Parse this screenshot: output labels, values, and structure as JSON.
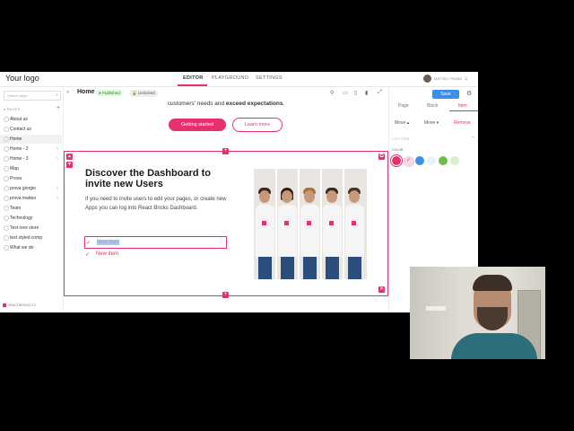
{
  "app": {
    "logo": "Your logo",
    "user_name": "MATTEO FRANA"
  },
  "top_nav": [
    {
      "label": "EDITOR",
      "active": true
    },
    {
      "label": "PLAYGROUND",
      "active": false
    },
    {
      "label": "SETTINGS",
      "active": false
    }
  ],
  "sidebar": {
    "search_placeholder": "Search page",
    "section_label": "PAGES",
    "items": [
      {
        "label": "About us"
      },
      {
        "label": "Contact us"
      },
      {
        "label": "Home",
        "active": true
      },
      {
        "label": "Home - 2"
      },
      {
        "label": "Home - 3"
      },
      {
        "label": "Map"
      },
      {
        "label": "Prova"
      },
      {
        "label": "prova giorgio"
      },
      {
        "label": "prova matteo"
      },
      {
        "label": "Team"
      },
      {
        "label": "Technology"
      },
      {
        "label": "Test new store"
      },
      {
        "label": "test styled comp"
      },
      {
        "label": "What we do"
      }
    ],
    "footer": "REACTBRICKS 2.0"
  },
  "toolbar": {
    "page_title": "Home",
    "status_published": "Published",
    "status_unlocked": "Unlocked"
  },
  "canvas": {
    "hero_text_1": "customers' needs and ",
    "hero_text_bold": "exceed expectations",
    "hero_text_end": ".",
    "btn_primary": "Getting started",
    "btn_secondary": "Learn more",
    "heading": "Discover the Dashboard to invite new Users",
    "paragraph": "If you need to invite users to edit your pages, or create new Apps you can log into React Bricks Dashboard.",
    "list_items": [
      {
        "text": "New item",
        "selected": true
      },
      {
        "text": "New item",
        "selected": false
      }
    ]
  },
  "right_panel": {
    "save_label": "Save",
    "tabs": [
      {
        "label": "Page",
        "active": false
      },
      {
        "label": "Block",
        "active": false
      },
      {
        "label": "Item",
        "active": true
      }
    ],
    "actions": {
      "move_up": "Move",
      "move_down": "Move",
      "remove": "Remove"
    },
    "section": "LIST ITEM",
    "color_label": "COLOR",
    "colors": [
      "#e5316f",
      "#f7dde6",
      "#3d8fe3",
      "#e9f1fb",
      "#6bbf45",
      "#d8efcc"
    ]
  }
}
